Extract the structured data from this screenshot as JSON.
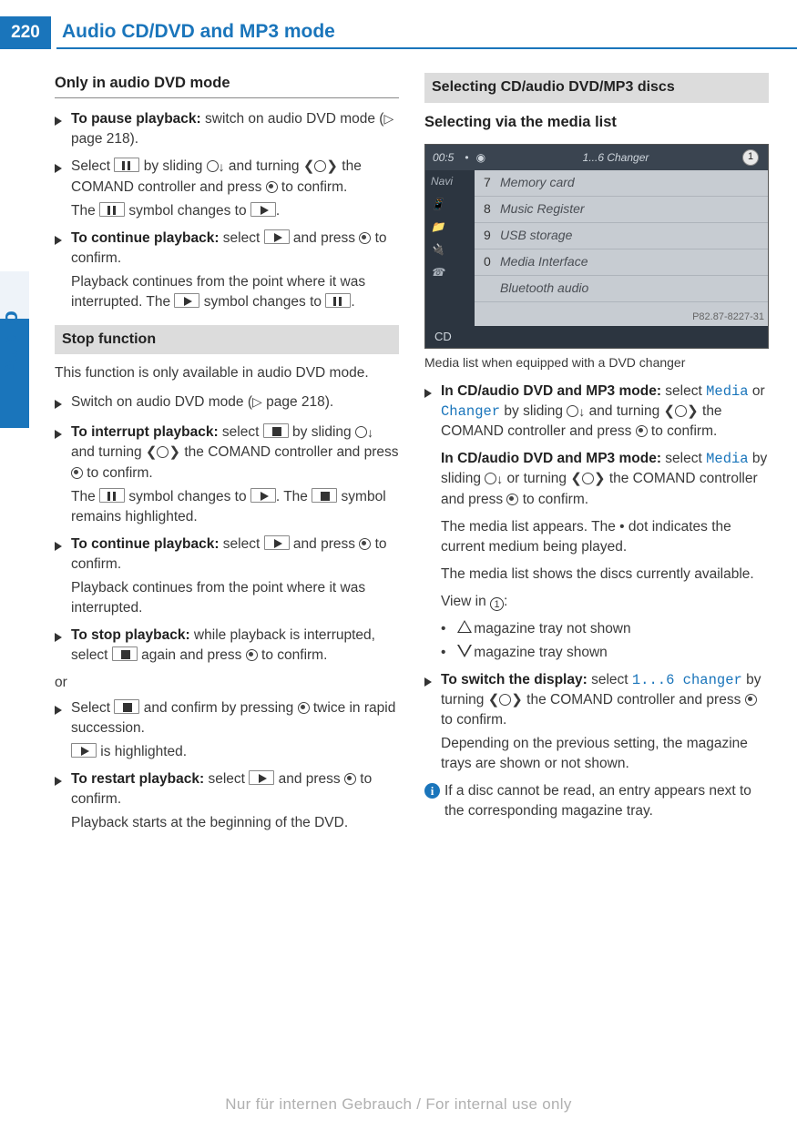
{
  "page_number": "220",
  "header_title": "Audio CD/DVD and MP3 mode",
  "side_tab": "Audio",
  "footer": "Nur für internen Gebrauch / For internal use only",
  "left": {
    "h_only": "Only in audio DVD mode",
    "pause_bold": "To pause playback:",
    "pause_rest": " switch on audio DVD mode (",
    "pause_ref": " page 218).",
    "sel1a": "Select ",
    "sel1b": " by sliding ",
    "sel1c": " and turning ",
    "sel1d": " the COMAND controller and press ",
    "sel1e": " to confirm.",
    "sel1f": "The ",
    "sel1g": " symbol changes to ",
    "sel1h": ".",
    "cont_bold": "To continue playback:",
    "cont_a": " select ",
    "cont_b": " and press ",
    "cont_c": " to confirm.",
    "cont_d": "Playback continues from the point where it was interrupted. The ",
    "cont_e": " symbol changes to ",
    "cont_f": ".",
    "stop_head": "Stop function",
    "stop_intro": "This function is only available in audio DVD mode.",
    "sw_a": "Switch on audio DVD mode (",
    "sw_b": " page 218).",
    "int_bold": "To interrupt playback:",
    "int_a": " select ",
    "int_b": " by sliding ",
    "int_c": " and turning ",
    "int_d": " the COMAND controller and press ",
    "int_e": " to confirm.",
    "int_f": "The ",
    "int_g": " symbol changes to ",
    "int_h": ". The ",
    "int_i": " symbol remains highlighted.",
    "c2_bold": "To continue playback:",
    "c2_a": " select ",
    "c2_b": " and press ",
    "c2_c": " to confirm.",
    "c2_d": "Playback continues from the point where it was interrupted.",
    "stp_bold": "To stop playback:",
    "stp_a": " while playback is interrupted, select ",
    "stp_b": " again and press ",
    "stp_c": " to confirm.",
    "or": "or",
    "alt_a": "Select ",
    "alt_b": " and confirm by pressing ",
    "alt_c": " twice in rapid succession.",
    "alt_d": " is highlighted.",
    "rs_bold": "To restart playback:",
    "rs_a": " select ",
    "rs_b": " and press ",
    "rs_c": " to confirm.",
    "rs_d": "Playback starts at the beginning of the DVD."
  },
  "right": {
    "head1": "Selecting CD/audio DVD/MP3 discs",
    "head2": "Selecting via the media list",
    "shot": {
      "time": "00:5",
      "title": "1...6 Changer",
      "circ": "1",
      "side1": "Navi",
      "cd": "CD",
      "items": [
        {
          "n": "7",
          "t": "Memory card"
        },
        {
          "n": "8",
          "t": "Music Register"
        },
        {
          "n": "9",
          "t": "USB storage"
        },
        {
          "n": "0",
          "t": "Media Interface"
        },
        {
          "n": "",
          "t": "Bluetooth audio"
        }
      ],
      "ref": "P82.87-8227-31"
    },
    "caption": "Media list when equipped with a DVD changer",
    "m1_bold": "In CD/audio DVD and MP3 mode:",
    "m1_a": " select ",
    "m1_m1": "Media",
    "m1_or": " or ",
    "m1_m2": "Changer",
    "m1_b": " by sliding ",
    "m1_c": " and turning ",
    "m1_d": " the COMAND controller and press ",
    "m1_e": " to confirm.",
    "m2_bold": "In CD/audio DVD and MP3 mode:",
    "m2_a": " select ",
    "m2_m1": "Media",
    "m2_b": " by sliding ",
    "m2_c": " or turning ",
    "m2_d": " the COMAND controller and press ",
    "m2_e": " to confirm.",
    "m2_f": "The media list appears. The • dot indicates the current medium being played.",
    "m2_g": "The media list shows the discs currently available.",
    "m2_h": "View in ",
    "m2_i": ":",
    "b1": " magazine tray not shown",
    "b2": " magazine tray shown",
    "sw_bold": "To switch the display:",
    "sw_a": " select ",
    "sw_m": "1...6 changer",
    "sw_b": " by turning ",
    "sw_c": " the COMAND controller and press ",
    "sw_d": " to confirm.",
    "sw_e": "Depending on the previous setting, the magazine trays are shown or not shown.",
    "info": "If a disc cannot be read, an entry appears next to the corresponding magazine tray."
  }
}
